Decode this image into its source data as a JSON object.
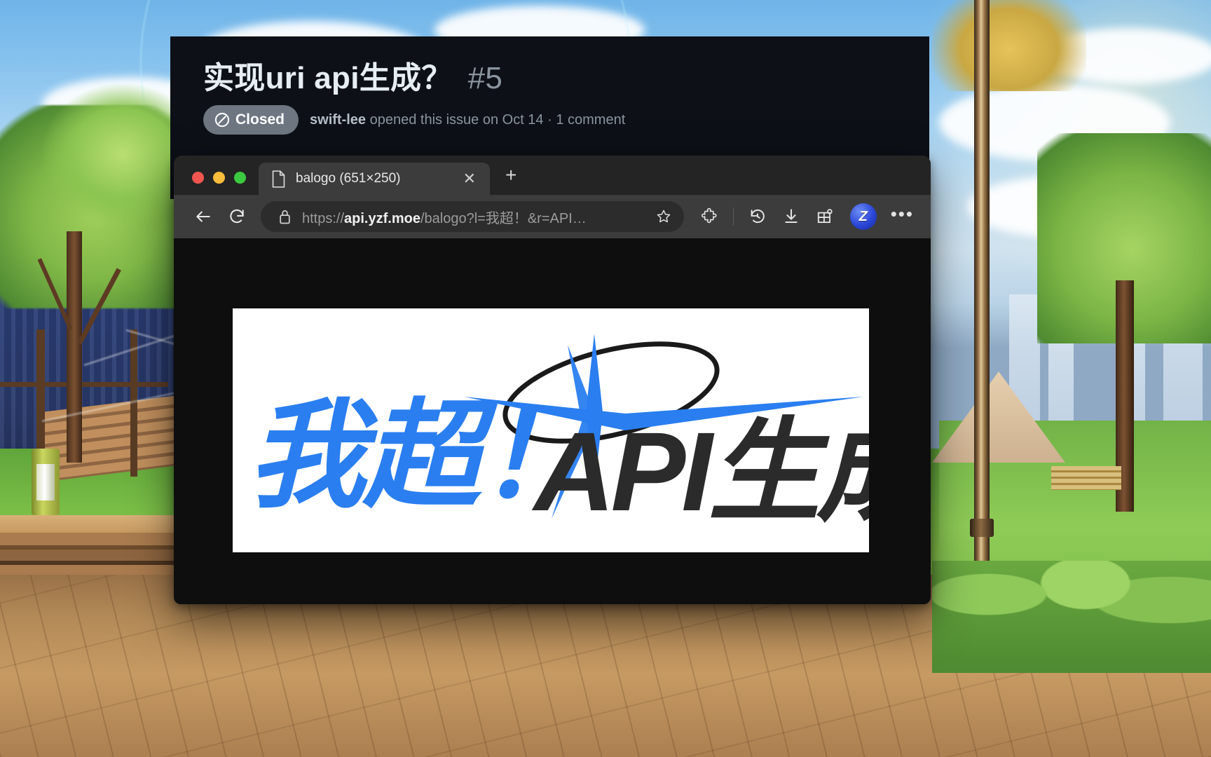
{
  "issue": {
    "title": "实现uri api生成？",
    "number": "#5",
    "state_label": "Closed",
    "state_icon": "issue-closed-icon",
    "author": "swift-lee",
    "meta_text": "opened this issue on Oct 14 · 1 comment",
    "meta_full": "swift-lee opened this issue on Oct 14 · 1 comment"
  },
  "browser": {
    "window_controls": {
      "close": "close-window",
      "minimize": "minimize-window",
      "zoom": "zoom-window"
    },
    "tab": {
      "title": "balogo (651×250)",
      "favicon": "document-icon",
      "close_label": "✕"
    },
    "new_tab_label": "+",
    "toolbar": {
      "back_label": "←",
      "reload_label": "⟳",
      "lock_icon": "lock-icon",
      "url_prefix": "https://",
      "url_host": "api.yzf.moe",
      "url_path": "/balogo?l=我超！&r=API…",
      "url_full": "https://api.yzf.moe/balogo?l=我超！&r=API…",
      "star_icon": "bookmark-star-icon",
      "extensions_icon": "extensions-puzzle-icon",
      "history_icon": "history-clock-icon",
      "downloads_icon": "download-arrow-icon",
      "collections_icon": "gift-box-icon",
      "avatar_icon": "profile-avatar-icon",
      "avatar_initial": "Z",
      "menu_label": "•••"
    }
  },
  "logo": {
    "left_text": "我超！",
    "right_text": "API生成",
    "left_color": "#2a7ef0",
    "right_color": "#2b2b2b",
    "accent_color": "#2a7ef0",
    "background": "#ffffff",
    "halo_color": "#1a1a1a",
    "dimensions": "651×250"
  },
  "colors": {
    "github_bg": "#0d1117",
    "github_text": "#e6edf3",
    "github_muted": "#8b949e",
    "badge_closed": "#6e7681",
    "browser_chrome": "#3c3c3c",
    "browser_tabstrip": "#242424",
    "page_bg": "#0e0e0e"
  }
}
